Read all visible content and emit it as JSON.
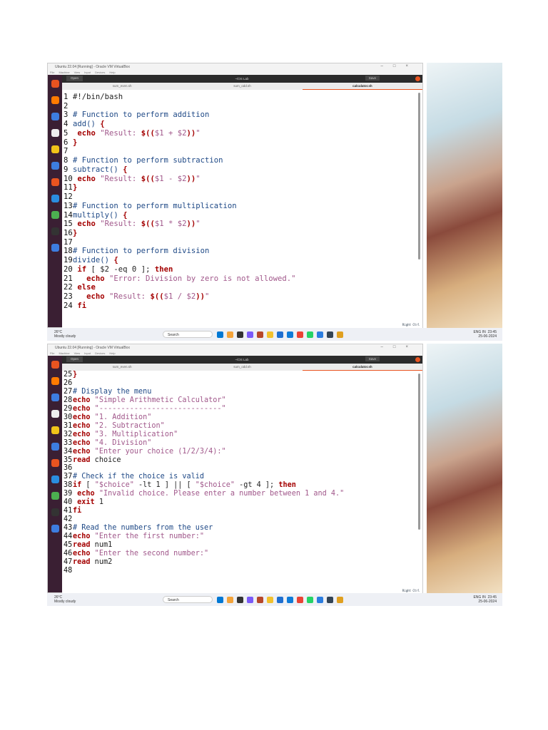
{
  "window": {
    "title": "Ubuntu 22.04 [Running] - Oracle VM VirtualBox",
    "menu": [
      "File",
      "Machine",
      "View",
      "Input",
      "Devices",
      "Help"
    ]
  },
  "editor": {
    "open_label": "Open",
    "path": "~/OS Lab",
    "save_label": "Save",
    "tabs": [
      "sum_even.sh",
      "sum_odd.sh",
      "calculator.sh"
    ],
    "active_tab": 2
  },
  "host_key": "Right Ctrl",
  "taskbar": {
    "temp": "26°C",
    "weather": "Mostly cloudy",
    "search": "Search",
    "lang": "ENG IN",
    "time": "23:45",
    "date": "25-06-2024"
  },
  "screens": [
    {
      "lines": [
        {
          "n": "1",
          "t": [
            [
              "",
              "#!/bin/bash"
            ]
          ]
        },
        {
          "n": "2",
          "t": []
        },
        {
          "n": "3",
          "t": [
            [
              "cm",
              "# Function to perform addition"
            ]
          ]
        },
        {
          "n": "4",
          "t": [
            [
              "fn",
              "add() "
            ],
            [
              "kw",
              "{"
            ]
          ]
        },
        {
          "n": "5",
          "t": [
            [
              "",
              " "
            ],
            [
              "kw",
              "echo"
            ],
            [
              "st",
              " \"Result: "
            ],
            [
              "kw",
              "$(("
            ],
            [
              "st",
              "$1 + $2"
            ],
            [
              "kw",
              "))"
            ],
            [
              "st",
              "\""
            ]
          ]
        },
        {
          "n": "6",
          "t": [
            [
              "kw",
              "}"
            ]
          ]
        },
        {
          "n": "7",
          "t": []
        },
        {
          "n": "8",
          "t": [
            [
              "cm",
              "# Function to perform subtraction"
            ]
          ]
        },
        {
          "n": "9",
          "t": [
            [
              "fn",
              "subtract() "
            ],
            [
              "kw",
              "{"
            ]
          ]
        },
        {
          "n": "10",
          "t": [
            [
              "",
              " "
            ],
            [
              "kw",
              "echo"
            ],
            [
              "st",
              " \"Result: "
            ],
            [
              "kw",
              "$(("
            ],
            [
              "st",
              "$1 - $2"
            ],
            [
              "kw",
              "))"
            ],
            [
              "st",
              "\""
            ]
          ]
        },
        {
          "n": "11",
          "t": [
            [
              "kw",
              "}"
            ]
          ]
        },
        {
          "n": "12",
          "t": []
        },
        {
          "n": "13",
          "t": [
            [
              "cm",
              "# Function to perform multiplication"
            ]
          ]
        },
        {
          "n": "14",
          "t": [
            [
              "fn",
              "multiply() "
            ],
            [
              "kw",
              "{"
            ]
          ]
        },
        {
          "n": "15",
          "t": [
            [
              "",
              " "
            ],
            [
              "kw",
              "echo"
            ],
            [
              "st",
              " \"Result: "
            ],
            [
              "kw",
              "$(("
            ],
            [
              "st",
              "$1 * $2"
            ],
            [
              "kw",
              "))"
            ],
            [
              "st",
              "\""
            ]
          ]
        },
        {
          "n": "16",
          "t": [
            [
              "kw",
              "}"
            ]
          ]
        },
        {
          "n": "17",
          "t": []
        },
        {
          "n": "18",
          "t": [
            [
              "cm",
              "# Function to perform division"
            ]
          ]
        },
        {
          "n": "19",
          "t": [
            [
              "fn",
              "divide() "
            ],
            [
              "kw",
              "{"
            ]
          ]
        },
        {
          "n": "20",
          "t": [
            [
              "",
              " "
            ],
            [
              "kw",
              "if"
            ],
            [
              "",
              " [ $2 -eq 0 ]; "
            ],
            [
              "kw",
              "then"
            ]
          ]
        },
        {
          "n": "21",
          "t": [
            [
              "",
              "   "
            ],
            [
              "kw",
              "echo"
            ],
            [
              "st",
              " \"Error: Division by zero is not allowed.\""
            ]
          ]
        },
        {
          "n": "22",
          "t": [
            [
              "",
              " "
            ],
            [
              "kw",
              "else"
            ]
          ]
        },
        {
          "n": "23",
          "t": [
            [
              "",
              "   "
            ],
            [
              "kw",
              "echo"
            ],
            [
              "st",
              " \"Result: "
            ],
            [
              "kw",
              "$(("
            ],
            [
              "st",
              "$1 / $2"
            ],
            [
              "kw",
              "))"
            ],
            [
              "st",
              "\""
            ]
          ]
        },
        {
          "n": "24",
          "t": [
            [
              "",
              " "
            ],
            [
              "kw",
              "fi"
            ]
          ]
        }
      ]
    },
    {
      "lines": [
        {
          "n": "25",
          "t": [
            [
              "kw",
              "}"
            ]
          ]
        },
        {
          "n": "26",
          "t": []
        },
        {
          "n": "27",
          "t": [
            [
              "cm",
              "# Display the menu"
            ]
          ]
        },
        {
          "n": "28",
          "t": [
            [
              "kw",
              "echo"
            ],
            [
              "st",
              " \"Simple Arithmetic Calculator\""
            ]
          ]
        },
        {
          "n": "29",
          "t": [
            [
              "kw",
              "echo"
            ],
            [
              "st",
              " \"----------------------------\""
            ]
          ]
        },
        {
          "n": "30",
          "t": [
            [
              "kw",
              "echo"
            ],
            [
              "st",
              " \"1. Addition\""
            ]
          ]
        },
        {
          "n": "31",
          "t": [
            [
              "kw",
              "echo"
            ],
            [
              "st",
              " \"2. Subtraction\""
            ]
          ]
        },
        {
          "n": "32",
          "t": [
            [
              "kw",
              "echo"
            ],
            [
              "st",
              " \"3. Multiplication\""
            ]
          ]
        },
        {
          "n": "33",
          "t": [
            [
              "kw",
              "echo"
            ],
            [
              "st",
              " \"4. Division\""
            ]
          ]
        },
        {
          "n": "34",
          "t": [
            [
              "kw",
              "echo"
            ],
            [
              "st",
              " \"Enter your choice (1/2/3/4):\""
            ]
          ]
        },
        {
          "n": "35",
          "t": [
            [
              "kw",
              "read"
            ],
            [
              "",
              " choice"
            ]
          ]
        },
        {
          "n": "36",
          "t": []
        },
        {
          "n": "37",
          "t": [
            [
              "cm",
              "# Check if the choice is valid"
            ]
          ]
        },
        {
          "n": "38",
          "t": [
            [
              "kw",
              "if"
            ],
            [
              "",
              " [ "
            ],
            [
              "st",
              "\"$choice\""
            ],
            [
              "",
              " -lt 1 ] || [ "
            ],
            [
              "st",
              "\"$choice\""
            ],
            [
              "",
              " -gt 4 ]; "
            ],
            [
              "kw",
              "then"
            ]
          ]
        },
        {
          "n": "39",
          "t": [
            [
              "",
              " "
            ],
            [
              "kw",
              "echo"
            ],
            [
              "st",
              " \"Invalid choice. Please enter a number between 1 and 4.\""
            ]
          ]
        },
        {
          "n": "40",
          "t": [
            [
              "",
              " "
            ],
            [
              "kw",
              "exit"
            ],
            [
              "",
              " 1"
            ]
          ]
        },
        {
          "n": "41",
          "t": [
            [
              "kw",
              "fi"
            ]
          ]
        },
        {
          "n": "42",
          "t": []
        },
        {
          "n": "43",
          "t": [
            [
              "cm",
              "# Read the numbers from the user"
            ]
          ]
        },
        {
          "n": "44",
          "t": [
            [
              "kw",
              "echo"
            ],
            [
              "st",
              " \"Enter the first number:\""
            ]
          ]
        },
        {
          "n": "45",
          "t": [
            [
              "kw",
              "read"
            ],
            [
              "",
              " num1"
            ]
          ]
        },
        {
          "n": "46",
          "t": [
            [
              "kw",
              "echo"
            ],
            [
              "st",
              " \"Enter the second number:\""
            ]
          ]
        },
        {
          "n": "47",
          "t": [
            [
              "kw",
              "read"
            ],
            [
              "",
              " num2"
            ]
          ]
        },
        {
          "n": "48",
          "t": []
        }
      ]
    }
  ]
}
